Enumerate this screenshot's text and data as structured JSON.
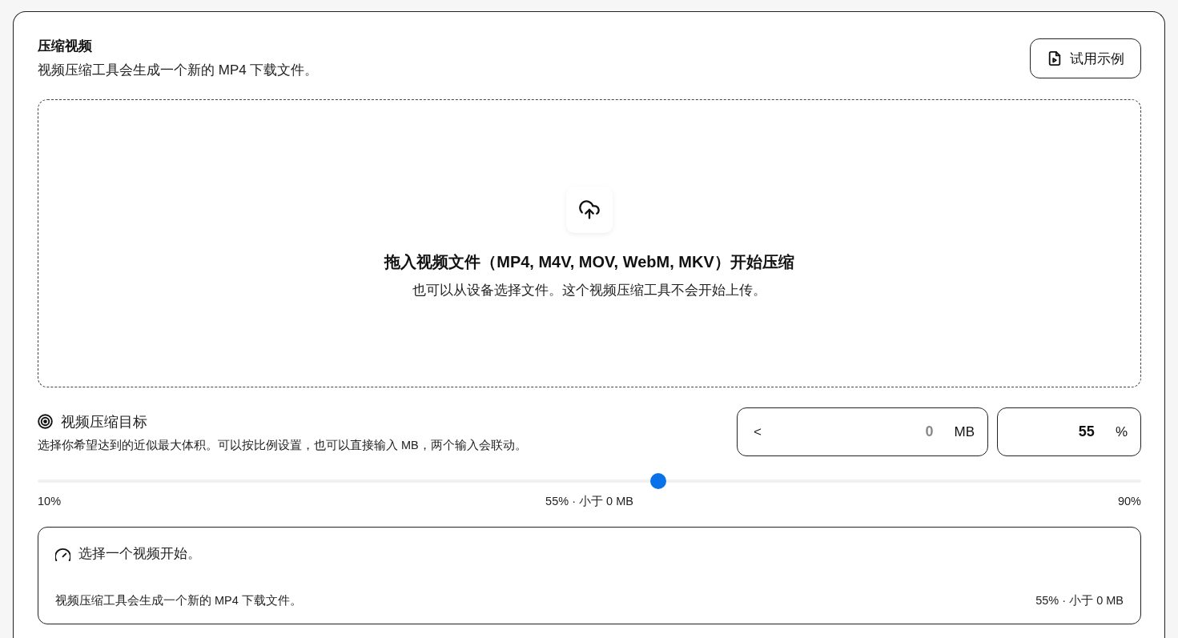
{
  "header": {
    "title": "压缩视频",
    "subtitle": "视频压缩工具会生成一个新的 MP4 下载文件。",
    "sample_button": {
      "label": "试用示例"
    }
  },
  "dropzone": {
    "title": "拖入视频文件（MP4, M4V, MOV, WebM, MKV）开始压缩",
    "hint": "也可以从设备选择文件。这个视频压缩工具不会开始上传。"
  },
  "target": {
    "title": "视频压缩目标",
    "description": "选择你希望达到的近似最大体积。可以按比例设置，也可以直接输入 MB，两个输入会联动。",
    "size_field": {
      "prefix": "<",
      "placeholder": "0",
      "unit": "MB"
    },
    "percent_field": {
      "value": "55",
      "unit": "%"
    }
  },
  "slider": {
    "level": 0.5625,
    "min_label": "10%",
    "value_label": "55% · 小于 0 MB",
    "max_label": "90%"
  },
  "status": {
    "message": "选择一个视频开始。",
    "note": "视频压缩工具会生成一个新的 MP4 下载文件。",
    "summary": "55% · 小于 0 MB"
  }
}
